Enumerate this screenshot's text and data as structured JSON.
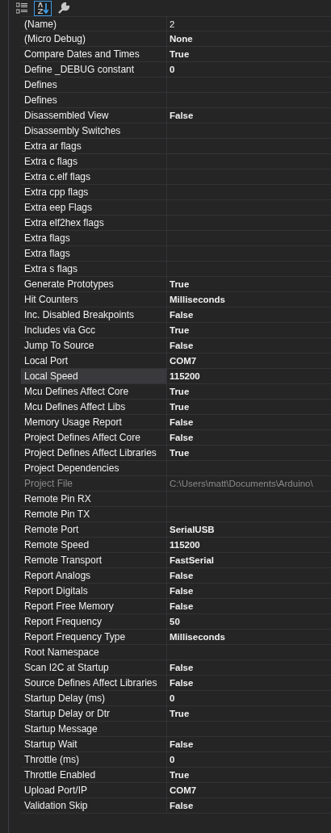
{
  "toolbar": [
    {
      "kind": "categorized",
      "selected": false
    },
    {
      "kind": "alphabetical",
      "selected": true
    },
    {
      "kind": "property_pages",
      "selected": false
    }
  ],
  "rows": [
    {
      "name": "(Name)",
      "value": "2",
      "bold": false,
      "disabled": false,
      "selected": false
    },
    {
      "name": "(Micro Debug)",
      "value": "None",
      "bold": true,
      "disabled": false,
      "selected": false
    },
    {
      "name": "Compare Dates and Times",
      "value": "True",
      "bold": true,
      "disabled": false,
      "selected": false
    },
    {
      "name": "Define _DEBUG constant",
      "value": "0",
      "bold": true,
      "disabled": false,
      "selected": false
    },
    {
      "name": "Defines",
      "disabled": false,
      "selected": false
    },
    {
      "name": "Defines",
      "disabled": false,
      "selected": false
    },
    {
      "name": "Disassembled View",
      "value": "False",
      "bold": true,
      "disabled": false,
      "selected": false
    },
    {
      "name": "Disassembly Switches",
      "disabled": false,
      "selected": false
    },
    {
      "name": "Extra ar flags",
      "disabled": false,
      "selected": false
    },
    {
      "name": "Extra c flags",
      "disabled": false,
      "selected": false
    },
    {
      "name": "Extra c.elf flags",
      "disabled": false,
      "selected": false
    },
    {
      "name": "Extra cpp flags",
      "disabled": false,
      "selected": false
    },
    {
      "name": "Extra eep Flags",
      "disabled": false,
      "selected": false
    },
    {
      "name": "Extra elf2hex flags",
      "disabled": false,
      "selected": false
    },
    {
      "name": "Extra flags",
      "disabled": false,
      "selected": false
    },
    {
      "name": "Extra flags",
      "disabled": false,
      "selected": false
    },
    {
      "name": "Extra s flags",
      "disabled": false,
      "selected": false
    },
    {
      "name": "Generate Prototypes",
      "value": "True",
      "bold": true,
      "disabled": false,
      "selected": false
    },
    {
      "name": "Hit Counters",
      "value": "Milliseconds",
      "bold": true,
      "disabled": false,
      "selected": false
    },
    {
      "name": "Inc. Disabled Breakpoints",
      "value": "False",
      "bold": true,
      "disabled": false,
      "selected": false
    },
    {
      "name": "Includes via Gcc",
      "value": "True",
      "bold": true,
      "disabled": false,
      "selected": false
    },
    {
      "name": "Jump To Source",
      "value": "False",
      "bold": true,
      "disabled": false,
      "selected": false
    },
    {
      "name": "Local Port",
      "value": "COM7",
      "bold": true,
      "disabled": false,
      "selected": false
    },
    {
      "name": "Local Speed",
      "value": "115200",
      "bold": true,
      "disabled": false,
      "selected": true
    },
    {
      "name": "Mcu Defines Affect Core",
      "value": "True",
      "bold": true,
      "disabled": false,
      "selected": false
    },
    {
      "name": "Mcu Defines Affect Libs",
      "value": "True",
      "bold": true,
      "disabled": false,
      "selected": false
    },
    {
      "name": "Memory Usage Report",
      "value": "False",
      "bold": true,
      "disabled": false,
      "selected": false
    },
    {
      "name": "Project Defines Affect Core",
      "value": "False",
      "bold": true,
      "disabled": false,
      "selected": false
    },
    {
      "name": "Project Defines Affect Libraries",
      "value": "True",
      "bold": true,
      "disabled": false,
      "selected": false
    },
    {
      "name": "Project Dependencies",
      "disabled": false,
      "selected": false
    },
    {
      "name": "Project File",
      "value": "C:\\Users\\matt\\Documents\\Arduino\\",
      "bold": false,
      "disabled": true,
      "selected": false
    },
    {
      "name": "Remote Pin RX",
      "disabled": false,
      "selected": false
    },
    {
      "name": "Remote Pin TX",
      "disabled": false,
      "selected": false
    },
    {
      "name": "Remote Port",
      "value": "SerialUSB",
      "bold": true,
      "disabled": false,
      "selected": false
    },
    {
      "name": "Remote Speed",
      "value": "115200",
      "bold": true,
      "disabled": false,
      "selected": false
    },
    {
      "name": "Remote Transport",
      "value": "FastSerial",
      "bold": true,
      "disabled": false,
      "selected": false
    },
    {
      "name": "Report Analogs",
      "value": "False",
      "bold": true,
      "disabled": false,
      "selected": false
    },
    {
      "name": "Report Digitals",
      "value": "False",
      "bold": true,
      "disabled": false,
      "selected": false
    },
    {
      "name": "Report Free Memory",
      "value": "False",
      "bold": true,
      "disabled": false,
      "selected": false
    },
    {
      "name": "Report Frequency",
      "value": "50",
      "bold": true,
      "disabled": false,
      "selected": false
    },
    {
      "name": "Report Frequency Type",
      "value": "Milliseconds",
      "bold": true,
      "disabled": false,
      "selected": false
    },
    {
      "name": "Root Namespace",
      "disabled": false,
      "selected": false
    },
    {
      "name": "Scan I2C at Startup",
      "value": "False",
      "bold": true,
      "disabled": false,
      "selected": false
    },
    {
      "name": "Source Defines Affect Libraries",
      "value": "False",
      "bold": true,
      "disabled": false,
      "selected": false
    },
    {
      "name": "Startup Delay (ms)",
      "value": "0",
      "bold": true,
      "disabled": false,
      "selected": false
    },
    {
      "name": "Startup Delay or Dtr",
      "value": "True",
      "bold": true,
      "disabled": false,
      "selected": false
    },
    {
      "name": "Startup Message",
      "disabled": false,
      "selected": false
    },
    {
      "name": "Startup Wait",
      "value": "False",
      "bold": true,
      "disabled": false,
      "selected": false
    },
    {
      "name": "Throttle (ms)",
      "value": "0",
      "bold": true,
      "disabled": false,
      "selected": false
    },
    {
      "name": "Throttle Enabled",
      "value": "True",
      "bold": true,
      "disabled": false,
      "selected": false
    },
    {
      "name": "Upload Port/IP",
      "value": "COM7",
      "bold": true,
      "disabled": false,
      "selected": false
    },
    {
      "name": "Validation Skip",
      "value": "False",
      "bold": true,
      "disabled": false,
      "selected": false
    }
  ]
}
